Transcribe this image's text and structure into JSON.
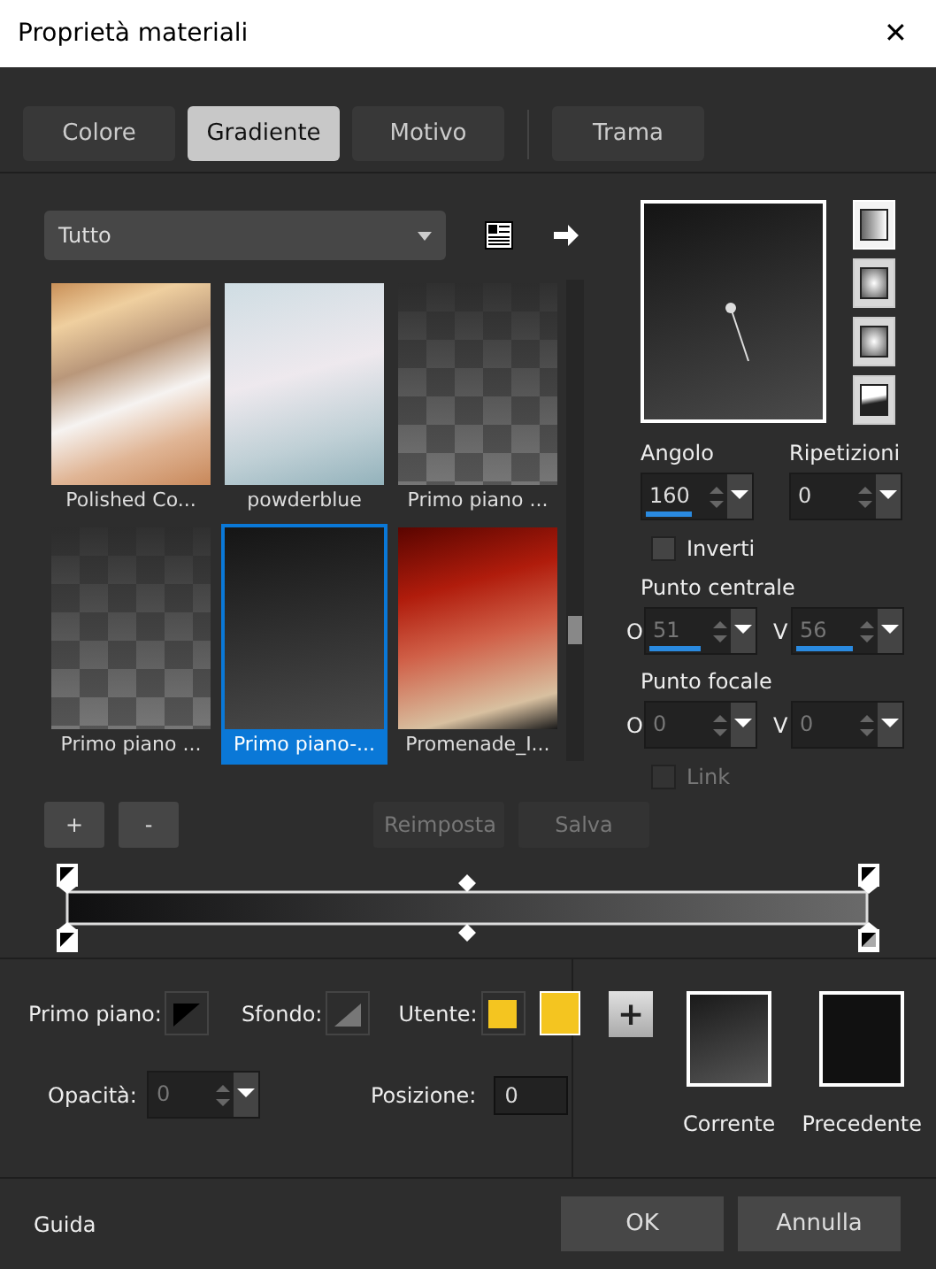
{
  "window": {
    "title": "Proprietà materiali",
    "close": "✕"
  },
  "tabs": [
    {
      "label": "Colore",
      "selected": false
    },
    {
      "label": "Gradiente",
      "selected": true
    },
    {
      "label": "Motivo",
      "selected": false
    },
    {
      "label": "Trama",
      "selected": false
    }
  ],
  "category": {
    "value": "Tutto"
  },
  "gradients": [
    {
      "name": "Polished Co...",
      "kind": "copper",
      "selected": false
    },
    {
      "name": "powderblue",
      "kind": "powder",
      "selected": false
    },
    {
      "name": "Primo piano ...",
      "kind": "checker",
      "selected": false
    },
    {
      "name": "Primo piano ...",
      "kind": "checker",
      "selected": false
    },
    {
      "name": "Primo piano-...",
      "kind": "dark",
      "selected": true
    },
    {
      "name": "Promenade_I...",
      "kind": "promenade",
      "selected": false
    }
  ],
  "styles": [
    {
      "kind": "linear",
      "selected": true
    },
    {
      "kind": "rectangular",
      "selected": false
    },
    {
      "kind": "radial",
      "selected": false
    },
    {
      "kind": "sunburst",
      "selected": false
    }
  ],
  "angle": {
    "label": "Angolo",
    "value": "160",
    "level": 0.44,
    "disabled": false
  },
  "repeats": {
    "label": "Ripetizioni",
    "value": "0",
    "disabled": false
  },
  "invert": {
    "label": "Inverti",
    "checked": false
  },
  "center": {
    "label": "Punto centrale",
    "fields": [
      {
        "axis": "O",
        "value": "51",
        "level": 0.5,
        "disabled": true
      },
      {
        "axis": "V",
        "value": "56",
        "level": 0.56,
        "disabled": true
      }
    ]
  },
  "focal": {
    "label": "Punto focale",
    "fields": [
      {
        "axis": "O",
        "value": "0",
        "disabled": true
      },
      {
        "axis": "V",
        "value": "0",
        "disabled": true
      }
    ]
  },
  "link": {
    "label": "Link",
    "checked": false,
    "disabled": true
  },
  "list_buttons": [
    {
      "label": "+",
      "disabled": false
    },
    {
      "label": "-",
      "disabled": false
    },
    {
      "label": "Reimposta",
      "disabled": true
    },
    {
      "label": "Salva",
      "disabled": true
    }
  ],
  "sources": [
    {
      "label": "Primo piano:",
      "kind": "foreground"
    },
    {
      "label": "Sfondo:",
      "kind": "background"
    },
    {
      "label": "Utente:",
      "kind": "user",
      "color": "#f4c520"
    }
  ],
  "opacity": {
    "label": "Opacità:",
    "value": "0",
    "disabled": true
  },
  "position": {
    "label": "Posizione:",
    "value": "0"
  },
  "add": {
    "label": "+"
  },
  "current": {
    "label": "Corrente"
  },
  "previous": {
    "label": "Precedente"
  },
  "help": "Guida",
  "buttons": [
    {
      "label": "OK"
    },
    {
      "label": "Annulla"
    }
  ]
}
